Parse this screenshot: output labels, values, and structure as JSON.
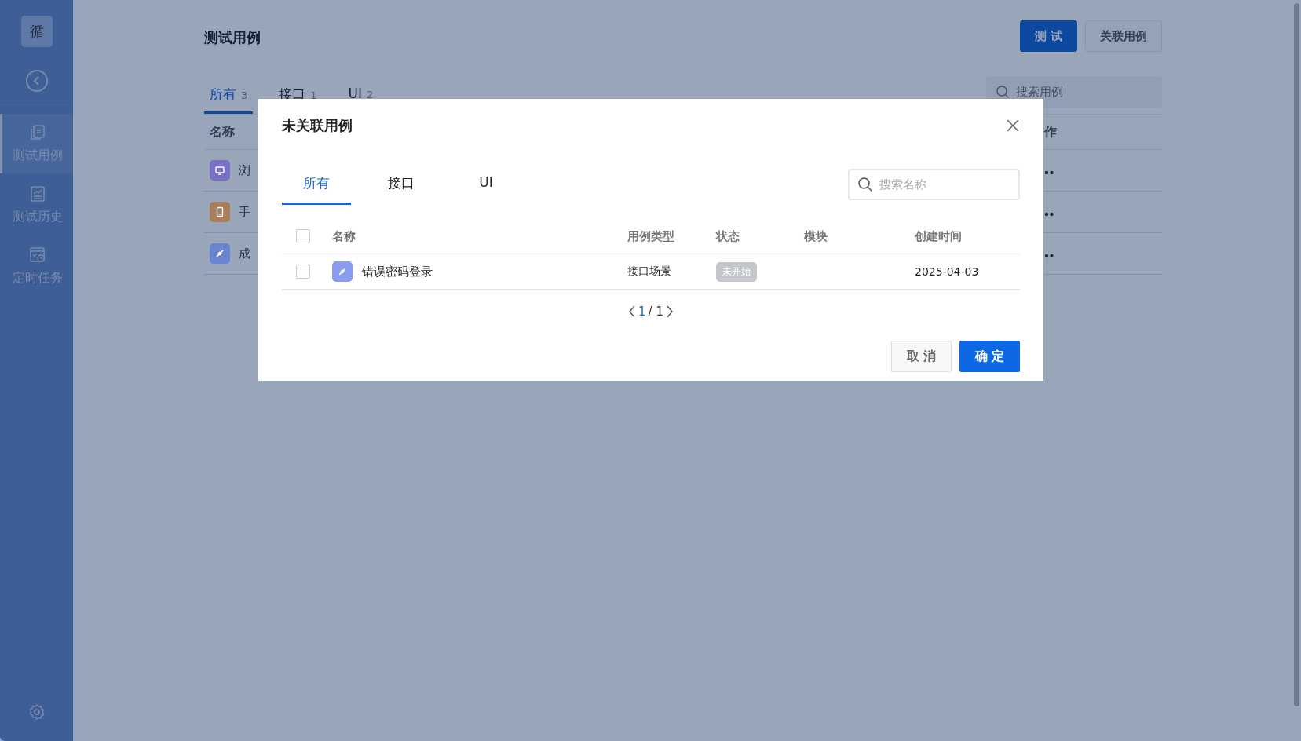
{
  "sidebar": {
    "logo": "循",
    "items": [
      {
        "label": "测试用例",
        "kind": "cases",
        "selected": true
      },
      {
        "label": "测试历史",
        "kind": "history",
        "selected": false
      },
      {
        "label": "定时任务",
        "kind": "schedule",
        "selected": false
      }
    ]
  },
  "page": {
    "title": "测试用例",
    "buttons": [
      {
        "label": "测 试",
        "kind": "primary"
      },
      {
        "label": "关联用例",
        "kind": "default"
      }
    ],
    "tabs": [
      {
        "label": "所有",
        "count": "3",
        "selected": true
      },
      {
        "label": "接口",
        "count": "1",
        "selected": false
      },
      {
        "label": "UI",
        "count": "2",
        "selected": false
      }
    ],
    "search": {
      "placeholder": "搜索用例"
    },
    "table": {
      "columns": [
        "名称",
        "作"
      ],
      "rows": [
        {
          "name": "浏",
          "kind": "monitor",
          "color": "#7a70c4"
        },
        {
          "name": "手",
          "kind": "tablet",
          "color": "#a87e5a"
        },
        {
          "name": "成",
          "kind": "plug",
          "color": "#6c84cf"
        }
      ]
    }
  },
  "dialog": {
    "title": "未关联用例",
    "tabs": [
      {
        "label": "所有",
        "selected": true
      },
      {
        "label": "接口",
        "selected": false
      },
      {
        "label": "UI",
        "selected": false
      }
    ],
    "search": {
      "placeholder": "搜索名称"
    },
    "table": {
      "all_checked": false,
      "columns": [
        "名称",
        "用例类型",
        "状态",
        "模块",
        "创建时间"
      ],
      "rows": [
        {
          "checked": false,
          "kind": "plug",
          "color": "#8a9cf0",
          "name": "错误密码登录",
          "type": "接口场景",
          "status": "未开始",
          "date": "2025-04-03"
        }
      ]
    },
    "pagination": {
      "current": "1",
      "total": "/ 1"
    },
    "buttons": [
      {
        "label": "取 消",
        "kind": "default"
      },
      {
        "label": "确 定",
        "kind": "primary"
      }
    ]
  }
}
